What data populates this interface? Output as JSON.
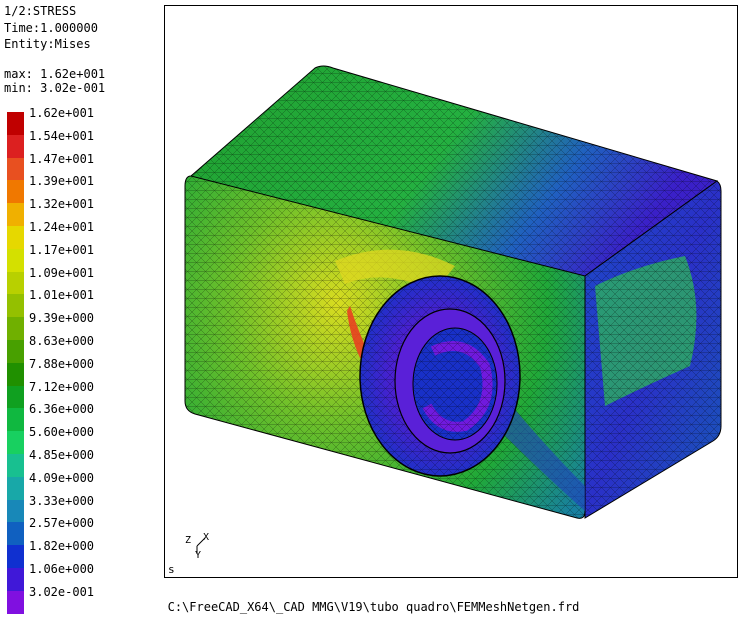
{
  "info": {
    "step": "1/2:STRESS",
    "time": "Time:1.000000",
    "entity": "Entity:Mises",
    "max": "max: 1.62e+001",
    "min": "min: 3.02e-001"
  },
  "legend": [
    {
      "label": "1.62e+001",
      "color": "#c00000"
    },
    {
      "label": "1.54e+001",
      "color": "#dc2020"
    },
    {
      "label": "1.47e+001",
      "color": "#e85020"
    },
    {
      "label": "1.39e+001",
      "color": "#f07800"
    },
    {
      "label": "1.32e+001",
      "color": "#f0b000"
    },
    {
      "label": "1.24e+001",
      "color": "#e6d800"
    },
    {
      "label": "1.17e+001",
      "color": "#d4e000"
    },
    {
      "label": "1.09e+001",
      "color": "#b8d000"
    },
    {
      "label": "1.01e+001",
      "color": "#94c000"
    },
    {
      "label": "9.39e+000",
      "color": "#70b000"
    },
    {
      "label": "8.63e+000",
      "color": "#48a000"
    },
    {
      "label": "7.88e+000",
      "color": "#209000"
    },
    {
      "label": "7.12e+000",
      "color": "#10a020"
    },
    {
      "label": "6.36e+000",
      "color": "#10b840"
    },
    {
      "label": "5.60e+000",
      "color": "#18d060"
    },
    {
      "label": "4.85e+000",
      "color": "#18c090"
    },
    {
      "label": "4.09e+000",
      "color": "#18a8a8"
    },
    {
      "label": "3.33e+000",
      "color": "#1888b8"
    },
    {
      "label": "2.57e+000",
      "color": "#1060c0"
    },
    {
      "label": "1.82e+000",
      "color": "#1030d0"
    },
    {
      "label": "1.06e+000",
      "color": "#4018d8"
    },
    {
      "label": "3.02e-001",
      "color": "#8010e0"
    }
  ],
  "viewport": {
    "corner_label": "s",
    "axes": {
      "z": "Z",
      "x": "X",
      "y": "Y"
    }
  },
  "footer": "C:\\FreeCAD_X64\\_CAD MMG\\V19\\tubo quadro\\FEMMeshNetgen.frd"
}
